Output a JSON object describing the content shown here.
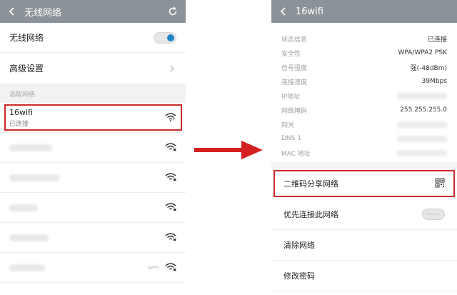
{
  "left": {
    "title": "无线网络",
    "wifi_toggle_label": "无线网络",
    "wifi_enabled": true,
    "advanced_label": "高级设置",
    "section_label": "选取网络",
    "connected_network": {
      "ssid": "16wifi",
      "status": "已连接"
    },
    "last_badge": "WPS"
  },
  "right": {
    "title": "16wifi",
    "details": [
      {
        "key": "状态信息",
        "value": "已连接"
      },
      {
        "key": "安全性",
        "value": "WPA/WPA2 PSK"
      },
      {
        "key": "信号强度",
        "value": "强(-48dBm)"
      },
      {
        "key": "连接速度",
        "value": "39Mbps"
      },
      {
        "key": "IP地址",
        "value": ""
      },
      {
        "key": "网络掩码",
        "value": "255.255.255.0"
      },
      {
        "key": "网关",
        "value": ""
      },
      {
        "key": "DNS 1",
        "value": ""
      },
      {
        "key": "MAC 地址",
        "value": ""
      }
    ],
    "actions": {
      "qr_share": "二维码分享网络",
      "priority": "优先连接此网络",
      "priority_enabled": false,
      "forget": "清除网络",
      "change_password": "修改密码"
    }
  },
  "colors": {
    "header": "#8c9398",
    "highlight": "#cc2b2b",
    "toggle_on": "#1e88c7",
    "arrow": "#d42020"
  }
}
